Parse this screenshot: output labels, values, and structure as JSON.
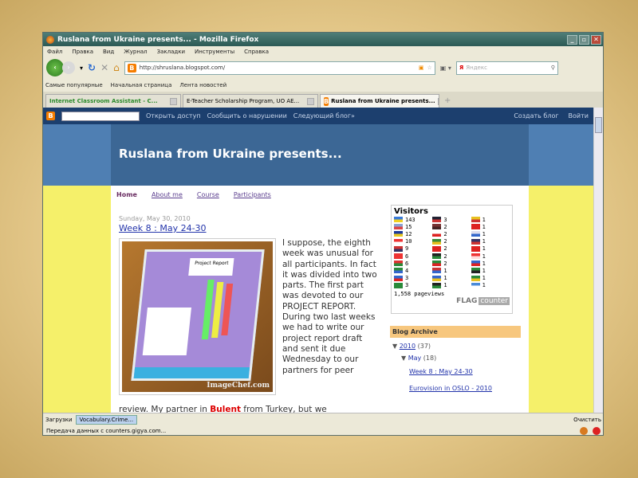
{
  "window": {
    "title": "Ruslana from Ukraine presents... - Mozilla Firefox"
  },
  "menu": [
    "Файл",
    "Правка",
    "Вид",
    "Журнал",
    "Закладки",
    "Инструменты",
    "Справка"
  ],
  "nav": {
    "url": "http://shruslana.blogspot.com/",
    "search_placeholder": "Яндекс"
  },
  "bookmarks": [
    "Самые популярные",
    "Начальная страница",
    "Лента новостей"
  ],
  "tabs": [
    {
      "label": "Internet Classroom Assistant - C..."
    },
    {
      "label": "E-Teacher Scholarship Program, UO AE..."
    },
    {
      "label": "Ruslana from Ukraine presents..."
    }
  ],
  "blogger_nav": {
    "links": [
      "Открыть доступ",
      "Сообщить о нарушении",
      "Следующий блог»"
    ],
    "right": [
      "Создать блог",
      "Войти"
    ]
  },
  "blog": {
    "title": "Ruslana from Ukraine presents...",
    "page_tabs": [
      "Home",
      "About me",
      "Course",
      "Participants"
    ],
    "post": {
      "date": "Sunday, May 30, 2010",
      "title": "Week 8 : May 24-30",
      "image_watermark": "ImageChef.com",
      "image_label": "Project Report",
      "text": "I suppose, the eighth week was unusual for all participants. In fact it was divided into two parts. The first part was devoted to our PROJECT REPORT. During two last weeks we had to write our project report draft and sent it due Wednesday to our partners for peer",
      "text2_a": "review. My partner in ",
      "text2_b": "Bulent",
      "text2_c": " from Turkey, but we"
    },
    "visitors": {
      "title": "Visitors",
      "pageviews": "1,558 pageviews",
      "brand_a": "FLAG",
      "brand_b": "counter",
      "flags": [
        {
          "c": "#3a7ad8",
          "c2": "#f0d020",
          "n": "143"
        },
        {
          "c": "#223",
          "c2": "#c33",
          "n": "3"
        },
        {
          "c": "#e8c020",
          "c2": "#c33",
          "n": "1"
        },
        {
          "c": "#8aa0d0",
          "c2": "#d44",
          "n": "15"
        },
        {
          "c": "#733",
          "c2": "#422",
          "n": "2"
        },
        {
          "c": "#d22",
          "c2": "#d22",
          "n": "1"
        },
        {
          "c": "#1a3a9a",
          "c2": "#e8c820",
          "n": "12"
        },
        {
          "c": "#fff",
          "c2": "#d22",
          "n": "2"
        },
        {
          "c": "#dde",
          "c2": "#36c",
          "n": "1"
        },
        {
          "c": "#e33",
          "c2": "#fff",
          "n": "10"
        },
        {
          "c": "#3a8a3a",
          "c2": "#e8c020",
          "n": "2"
        },
        {
          "c": "#336",
          "c2": "#c33",
          "n": "1"
        },
        {
          "c": "#c33",
          "c2": "#336",
          "n": "9"
        },
        {
          "c": "#d22",
          "c2": "#d22",
          "n": "2"
        },
        {
          "c": "#d22",
          "c2": "#d22",
          "n": "1"
        },
        {
          "c": "#e33",
          "c2": "#e33",
          "n": "6"
        },
        {
          "c": "#222",
          "c2": "#2a8a3a",
          "n": "2"
        },
        {
          "c": "#e33",
          "c2": "#fdd",
          "n": "1"
        },
        {
          "c": "#d33",
          "c2": "#2a8a3a",
          "n": "6"
        },
        {
          "c": "#2a8a3a",
          "c2": "#d22",
          "n": "2"
        },
        {
          "c": "#36c",
          "c2": "#d22",
          "n": "1"
        },
        {
          "c": "#2a8a3a",
          "c2": "#36c",
          "n": "4"
        },
        {
          "c": "#c33",
          "c2": "#36c",
          "n": "1"
        },
        {
          "c": "#2a8a3a",
          "c2": "#222",
          "n": "1"
        },
        {
          "c": "#36c",
          "c2": "#d22",
          "n": "3"
        },
        {
          "c": "#36c",
          "c2": "#e8c020",
          "n": "1"
        },
        {
          "c": "#2a8a3a",
          "c2": "#e8c020",
          "n": "1"
        },
        {
          "c": "#2a8a3a",
          "c2": "#2a8a3a",
          "n": "3"
        },
        {
          "c": "#222",
          "c2": "#2a8a3a",
          "n": "1"
        },
        {
          "c": "#4a8ad8",
          "c2": "#fff",
          "n": "1"
        }
      ]
    },
    "archive": {
      "title": "Blog Archive",
      "year": "2010",
      "year_count": "(37)",
      "month": "May",
      "month_count": "(18)",
      "posts": [
        "Week 8 : May 24-30",
        "Eurovision in OSLO - 2010"
      ]
    }
  },
  "downloads": {
    "label": "Загрузки",
    "item": "Vocabulary.Crime...",
    "clear": "Очистить"
  },
  "status": {
    "text": "Передача данных с counters.gigya.com..."
  }
}
